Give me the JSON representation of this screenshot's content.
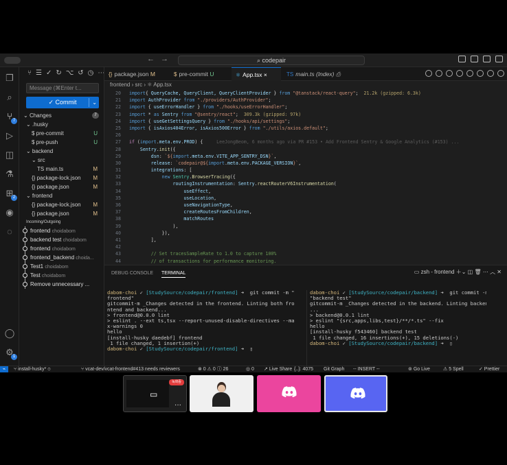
{
  "titlebar": {
    "search_label": "codepair",
    "nav_back": "←",
    "nav_fwd": "→"
  },
  "sidebar": {
    "message_placeholder": "Message (⌘Enter t...",
    "commit_label": "✓ Commit",
    "changes_label": "Changes",
    "changes_count": "7",
    "files": [
      {
        "label": "⌄ .husky",
        "status": ""
      },
      {
        "label": "$ pre-commit",
        "status": "U"
      },
      {
        "label": "$ pre-push",
        "status": "U"
      },
      {
        "label": "⌄ backend",
        "status": ""
      },
      {
        "label": "⌄ src",
        "status": ""
      },
      {
        "label": "TS main.ts",
        "status": "M"
      },
      {
        "label": "{} package-lock.json",
        "status": "M"
      },
      {
        "label": "{} package.json",
        "status": "M"
      },
      {
        "label": "⌄ frontend",
        "status": ""
      },
      {
        "label": "{} package-lock.json",
        "status": "M"
      },
      {
        "label": "{} package.json",
        "status": "M"
      }
    ],
    "graph_section": "Incoming/Outgoing",
    "graph": [
      {
        "msg": "frontend",
        "author": "choidabom"
      },
      {
        "msg": "backend test",
        "author": "choidabom"
      },
      {
        "msg": "frontend",
        "author": "choidabom"
      },
      {
        "msg": "frontend_backend",
        "author": "choida..."
      },
      {
        "msg": "Test1",
        "author": "choidabom"
      },
      {
        "msg": "Test",
        "author": "choidabom"
      },
      {
        "msg": "Remove unnecessary ...",
        "author": ""
      }
    ]
  },
  "tabs": [
    {
      "label": "package.json",
      "flag": "M",
      "icon": "{}"
    },
    {
      "label": "pre-commit",
      "flag": "U",
      "icon": "$"
    },
    {
      "label": "App.tsx",
      "flag": "×",
      "icon": "⚛"
    },
    {
      "label": "main.ts (Index)",
      "flag": "",
      "icon": "TS"
    }
  ],
  "breadcrumb": "frontend › src › ⚛ App.tsx",
  "code_lines": [
    {
      "n": "20",
      "parts": [
        [
          "kw",
          "import"
        ],
        [
          "",
          "{ "
        ],
        [
          "id",
          "QueryCache, QueryClient, QueryClientProvider"
        ],
        [
          "",
          " } "
        ],
        [
          "kw",
          "from"
        ],
        [
          "str",
          " \"@tanstack/react-query\""
        ],
        [
          "",
          ";  "
        ],
        [
          "sz",
          "21.2k (gzipped: 6.3k)"
        ]
      ]
    },
    {
      "n": "21",
      "parts": [
        [
          "kw",
          "import"
        ],
        [
          "id",
          " AuthProvider "
        ],
        [
          "kw",
          "from"
        ],
        [
          "str",
          " \"./providers/AuthProvider\""
        ],
        [
          "",
          ";"
        ]
      ]
    },
    {
      "n": "22",
      "parts": [
        [
          "kw",
          "import"
        ],
        [
          "",
          "",
          " { "
        ],
        [
          "id",
          "useErrorHandler"
        ],
        [
          "",
          " } "
        ],
        [
          "kw",
          "from"
        ],
        [
          "str",
          " \"./hooks/useErrorHandler\""
        ],
        [
          "",
          ";"
        ]
      ]
    },
    {
      "n": "23",
      "parts": [
        [
          "kw",
          "import"
        ],
        [
          "",
          " * "
        ],
        [
          "kw",
          "as"
        ],
        [
          "id",
          " Sentry "
        ],
        [
          "kw",
          "from"
        ],
        [
          "str",
          " \"@sentry/react\""
        ],
        [
          "",
          ";  "
        ],
        [
          "sz",
          "309.3k (gzipped: 97k)"
        ]
      ]
    },
    {
      "n": "24",
      "parts": [
        [
          "kw",
          "import"
        ],
        [
          "",
          " { "
        ],
        [
          "id",
          "useGetSettingsQuery"
        ],
        [
          "",
          " } "
        ],
        [
          "kw",
          "from"
        ],
        [
          "str",
          " \"./hooks/api/settings\""
        ],
        [
          "",
          ";"
        ]
      ]
    },
    {
      "n": "25",
      "parts": [
        [
          "kw",
          "import"
        ],
        [
          "",
          " { "
        ],
        [
          "id",
          "isAxios404Error, isAxios500Error"
        ],
        [
          "",
          " } "
        ],
        [
          "kw",
          "from"
        ],
        [
          "str",
          " \"./utils/axios.default\""
        ],
        [
          "",
          ";"
        ]
      ]
    },
    {
      "n": "26",
      "parts": [
        [
          "",
          ""
        ]
      ]
    },
    {
      "n": "27",
      "parts": [
        [
          "ctl",
          "if"
        ],
        [
          "",
          " ("
        ],
        [
          "kw",
          "import"
        ],
        [
          "",
          "."
        ],
        [
          "id",
          "meta"
        ],
        [
          "",
          "."
        ],
        [
          "id",
          "env"
        ],
        [
          "",
          "."
        ],
        [
          "id",
          "PROD"
        ],
        [
          "",
          ") {"
        ],
        [
          "blame",
          "     LeeJongBeom, 6 months ago via PR #153 • Add Frontend Sentry & Google Analytics (#153) ..."
        ]
      ]
    },
    {
      "n": "28",
      "parts": [
        [
          "",
          "    "
        ],
        [
          "id",
          "Sentry"
        ],
        [
          "",
          "."
        ],
        [
          "fn",
          "init"
        ],
        [
          "",
          "({"
        ]
      ]
    },
    {
      "n": "29",
      "parts": [
        [
          "",
          "        "
        ],
        [
          "id",
          "dsn"
        ],
        [
          "",
          ": "
        ],
        [
          "str",
          "`${"
        ],
        [
          "kw",
          "import"
        ],
        [
          "",
          "."
        ],
        [
          "id",
          "meta"
        ],
        [
          "",
          "."
        ],
        [
          "id",
          "env"
        ],
        [
          "",
          "."
        ],
        [
          "id",
          "VITE_APP_SENTRY_DSN"
        ],
        [
          "str",
          "}`"
        ],
        [
          "",
          ","
        ]
      ]
    },
    {
      "n": "30",
      "parts": [
        [
          "",
          "        "
        ],
        [
          "id",
          "release"
        ],
        [
          "",
          ": "
        ],
        [
          "str",
          "`codepair@${"
        ],
        [
          "kw",
          "import"
        ],
        [
          "",
          "."
        ],
        [
          "id",
          "meta"
        ],
        [
          "",
          "."
        ],
        [
          "id",
          "env"
        ],
        [
          "",
          "."
        ],
        [
          "id",
          "PACKAGE_VERSION"
        ],
        [
          "str",
          "}`"
        ],
        [
          "",
          ","
        ]
      ]
    },
    {
      "n": "31",
      "parts": [
        [
          "",
          "        "
        ],
        [
          "id",
          "integrations"
        ],
        [
          "",
          ": ["
        ]
      ]
    },
    {
      "n": "32",
      "parts": [
        [
          "",
          "            "
        ],
        [
          "kw",
          "new"
        ],
        [
          "ty",
          " Sentry"
        ],
        [
          "",
          "."
        ],
        [
          "fn",
          "BrowserTracing"
        ],
        [
          "",
          "({"
        ]
      ]
    },
    {
      "n": "33",
      "parts": [
        [
          "",
          "                "
        ],
        [
          "id",
          "routingInstrumentation"
        ],
        [
          "",
          ": "
        ],
        [
          "id",
          "Sentry"
        ],
        [
          "",
          "."
        ],
        [
          "fn",
          "reactRouterV6Instrumentation"
        ],
        [
          "",
          "("
        ]
      ]
    },
    {
      "n": "34",
      "parts": [
        [
          "",
          "                    "
        ],
        [
          "id",
          "useEffect"
        ],
        [
          "",
          ","
        ]
      ]
    },
    {
      "n": "35",
      "parts": [
        [
          "",
          "                    "
        ],
        [
          "id",
          "useLocation"
        ],
        [
          "",
          ","
        ]
      ]
    },
    {
      "n": "36",
      "parts": [
        [
          "",
          "                    "
        ],
        [
          "id",
          "useNavigationType"
        ],
        [
          "",
          ","
        ]
      ]
    },
    {
      "n": "37",
      "parts": [
        [
          "",
          "                    "
        ],
        [
          "id",
          "createRoutesFromChildren"
        ],
        [
          "",
          ","
        ]
      ]
    },
    {
      "n": "38",
      "parts": [
        [
          "",
          "                    "
        ],
        [
          "id",
          "matchRoutes"
        ]
      ]
    },
    {
      "n": "39",
      "parts": [
        [
          "",
          "                ),"
        ]
      ]
    },
    {
      "n": "40",
      "parts": [
        [
          "",
          "            }),"
        ]
      ]
    },
    {
      "n": "41",
      "parts": [
        [
          "",
          "        ],"
        ]
      ]
    },
    {
      "n": "42",
      "parts": [
        [
          "",
          ""
        ]
      ]
    },
    {
      "n": "43",
      "parts": [
        [
          "cm",
          "        // Set tracesSampleRate to 1.0 to capture 100%"
        ]
      ]
    },
    {
      "n": "44",
      "parts": [
        [
          "cm",
          "        // of transactions for performance monitoring."
        ]
      ]
    },
    {
      "n": "45",
      "parts": [
        [
          "cm",
          "        // We recommend adjusting this value in production"
        ]
      ]
    }
  ],
  "panel": {
    "tab_debug": "DEBUG CONSOLE",
    "tab_terminal": "TERMINAL",
    "shell_label": "zsh - frontend"
  },
  "terminal_left": [
    [
      [
        "tu",
        "dabom-choi"
      ],
      [
        "",
        " ✓ "
      ],
      [
        "tp",
        "[StudySource/codepair/frontend]"
      ],
      [
        "",
        " ➜  git commit -m \""
      ]
    ],
    [
      [
        "",
        "frontend\""
      ]
    ],
    [
      [
        "",
        "gitcommit-m _Changes detected in the frontend. Linting both fro"
      ]
    ],
    [
      [
        "",
        "ntend and backend..."
      ]
    ],
    [
      [
        "",
        ""
      ]
    ],
    [
      [
        "",
        "> frontend@0.0.0 lint"
      ]
    ],
    [
      [
        "",
        "> eslint . --ext ts,tsx --report-unused-disable-directives --ma"
      ]
    ],
    [
      [
        "",
        "x-warnings 0"
      ]
    ],
    [
      [
        "",
        ""
      ]
    ],
    [
      [
        "",
        "hello"
      ]
    ],
    [
      [
        "",
        "[install-husky daedebf] frontend"
      ]
    ],
    [
      [
        "",
        "",
        " 1 file changed, 1 insertion(+)"
      ]
    ],
    [
      [
        "tu",
        "dabom-choi"
      ],
      [
        "",
        " ✓ "
      ],
      [
        "tp",
        "[StudySource/codepair/frontend]"
      ],
      [
        "",
        " ➜  ▯"
      ]
    ]
  ],
  "terminal_right": [
    [
      [
        "tu",
        "dabom-choi"
      ],
      [
        "",
        " ✓ "
      ],
      [
        "tp",
        "[StudySource/codepair/backend]"
      ],
      [
        "",
        " ➜  git commit -m"
      ]
    ],
    [
      [
        "",
        "\"backend test\""
      ]
    ],
    [
      [
        "",
        "gitcommit-m _Changes detected in the backend. Linting backend"
      ]
    ],
    [
      [
        "",
        "..."
      ]
    ],
    [
      [
        "",
        ""
      ]
    ],
    [
      [
        "",
        "> backend@0.0.1 lint"
      ]
    ],
    [
      [
        "",
        "> eslint \"{src,apps,libs,test}/**/*.ts\" --fix"
      ]
    ],
    [
      [
        "",
        ""
      ]
    ],
    [
      [
        "",
        "hello"
      ]
    ],
    [
      [
        "",
        "[install-husky f543460] backend test"
      ]
    ],
    [
      [
        "",
        "",
        " 1 file changed, 16 insertions(+), 15 deletions(-)"
      ]
    ],
    [
      [
        "tu",
        "dabom-choi"
      ],
      [
        "",
        " ✓ "
      ],
      [
        "tp",
        "[StudySource/codepair/backend]"
      ],
      [
        "",
        " ➜  ▯"
      ]
    ]
  ],
  "status": {
    "branch": "install-husky*",
    "pr": "vcat-dev/vcat-frontend#413 needs reviewers",
    "problems": "⊗ 0 ⚠ 0 ⓘ 26",
    "ports": "◎ 0",
    "liveshare": "Live Share",
    "pos": "{..}: 4075",
    "graph": "Git Graph",
    "mode": "-- INSERT --",
    "golive": "Go Live",
    "spell": "⚠ 5 Spell",
    "prettier": "✓ Prettier"
  },
  "meeting": {
    "rec_label": "녹화중",
    "more": "···"
  }
}
